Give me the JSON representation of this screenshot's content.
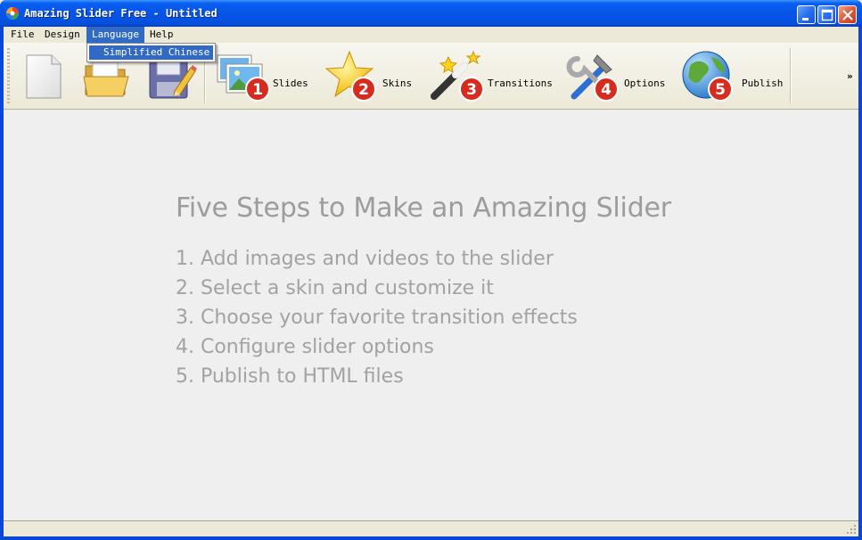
{
  "window": {
    "title": "Amazing Slider Free - Untitled",
    "colors": {
      "titlebar": "#0654e8",
      "accent": "#316ac5",
      "close": "#e0583a"
    }
  },
  "menu": {
    "items": [
      "File",
      "Design",
      "Language",
      "Help"
    ],
    "active": "Language",
    "dropdown": [
      "Simplified Chinese"
    ]
  },
  "toolbar": {
    "buttons": [
      {
        "icon": "new-document-icon"
      },
      {
        "icon": "open-folder-icon"
      },
      {
        "icon": "save-icon"
      },
      {
        "icon": "slides-icon",
        "label": "Slides",
        "step": "1"
      },
      {
        "icon": "skins-star-icon",
        "label": "Skins",
        "step": "2"
      },
      {
        "icon": "transitions-wand-icon",
        "label": "Transitions",
        "step": "3"
      },
      {
        "icon": "options-tools-icon",
        "label": "Options",
        "step": "4"
      },
      {
        "icon": "publish-globe-icon",
        "label": "Publish",
        "step": "5"
      }
    ],
    "overflow": "»",
    "badge_color": "#d62b1f"
  },
  "main": {
    "heading": "Five Steps to Make an Amazing Slider",
    "steps": [
      "1. Add images and videos to the slider",
      "2. Select a skin and customize it",
      "3. Choose your favorite transition effects",
      "4. Configure slider options",
      "5. Publish to HTML files"
    ]
  }
}
